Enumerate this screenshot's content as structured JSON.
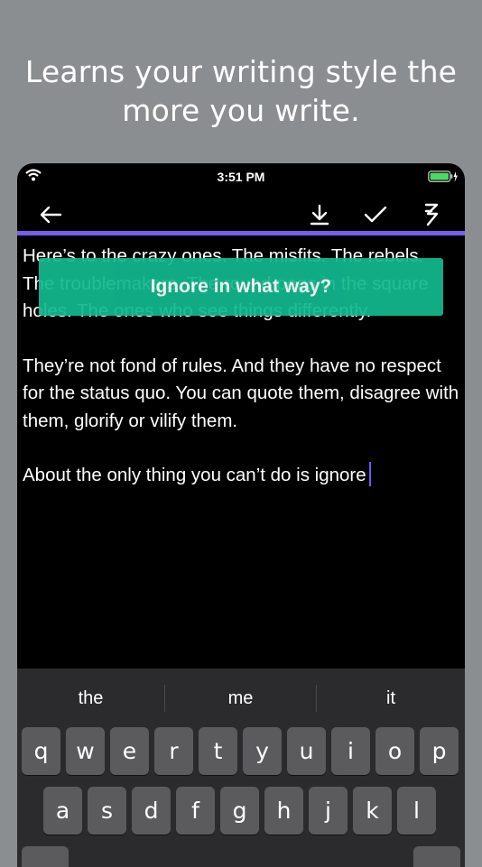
{
  "headline": {
    "line1": "Learns your writing style the",
    "line2": "more you write."
  },
  "status_bar": {
    "time": "3:51 PM",
    "icons": [
      "wifi-icon",
      "battery-charging-icon"
    ]
  },
  "toolbar": {
    "icons": [
      "back-arrow-icon",
      "download-icon",
      "checkmark-icon",
      "lightning-icon"
    ]
  },
  "editor": {
    "paragraph1": "Here’s to the crazy ones. The misfits. The rebels. The troublemakers. The round pegs in the square holes. The ones who see things differently.",
    "paragraph2": "They’re not fond of rules. And they have no respect for the status quo. You can quote them, disagree with them, glorify or vilify them.",
    "paragraph3": "About the only thing you can’t do is ignore"
  },
  "toast": {
    "text": "Ignore in what way?"
  },
  "colors": {
    "accent": "#7b5cf0",
    "toast": "#12b98e",
    "background": "#8b8e90"
  },
  "keyboard": {
    "suggestions": [
      "the",
      "me",
      "it"
    ],
    "row1": [
      "q",
      "w",
      "e",
      "r",
      "t",
      "y",
      "u",
      "i",
      "o",
      "p"
    ],
    "row2": [
      "a",
      "s",
      "d",
      "f",
      "g",
      "h",
      "j",
      "k",
      "l"
    ]
  }
}
